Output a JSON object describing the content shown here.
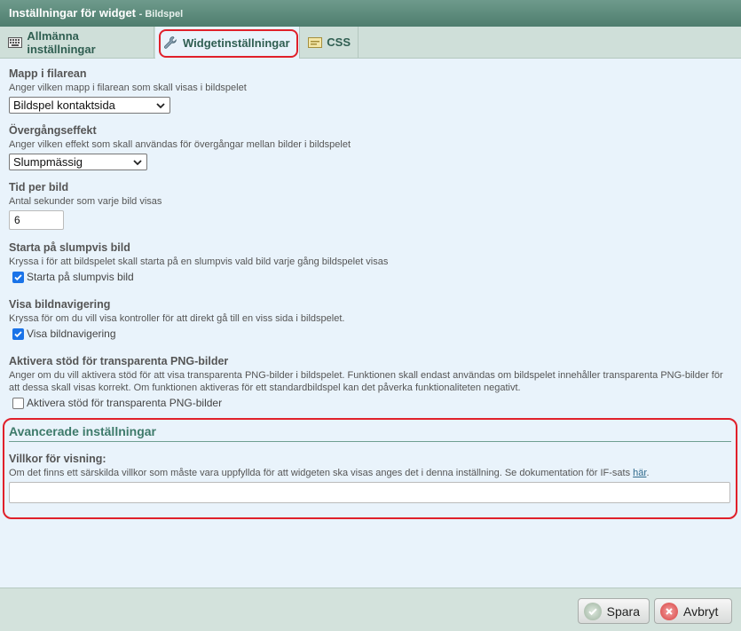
{
  "window": {
    "title": "Inställningar för widget",
    "subtitle": "- Bildspel"
  },
  "tabs": [
    {
      "label": "Allmänna inställningar",
      "icon": "keyboard-icon",
      "active": false
    },
    {
      "label": "Widgetinställningar",
      "icon": "wrench-icon",
      "active": true
    },
    {
      "label": "CSS",
      "icon": "css-icon",
      "active": false
    }
  ],
  "fields": {
    "folder": {
      "title": "Mapp i filarean",
      "desc": "Anger vilken mapp i filarean som skall visas i bildspelet",
      "value": "Bildspel kontaktsida"
    },
    "transition": {
      "title": "Övergångseffekt",
      "desc": "Anger vilken effekt som skall användas för övergångar mellan bilder i bildspelet",
      "value": "Slumpmässig"
    },
    "duration": {
      "title": "Tid per bild",
      "desc": "Antal sekunder som varje bild visas",
      "value": "6"
    },
    "random_start": {
      "title": "Starta på slumpvis bild",
      "desc": "Kryssa i för att bildspelet skall starta på en slumpvis vald bild varje gång bildspelet visas",
      "checkbox_label": "Starta på slumpvis bild",
      "checked": true
    },
    "navigation": {
      "title": "Visa bildnavigering",
      "desc": "Kryssa för om du vill visa kontroller för att direkt gå till en viss sida i bildspelet.",
      "checkbox_label": "Visa bildnavigering",
      "checked": true
    },
    "png": {
      "title": "Aktivera stöd för transparenta PNG-bilder",
      "desc": "Anger om du vill aktivera stöd för att visa transparenta PNG-bilder i bildspelet. Funktionen skall endast användas om bildspelet innehåller transparenta PNG-bilder för att dessa skall visas korrekt. Om funktionen aktiveras för ett standardbildspel kan det påverka funktionaliteten negativt.",
      "checkbox_label": "Aktivera stöd för transparenta PNG-bilder",
      "checked": false
    }
  },
  "advanced": {
    "heading": "Avancerade inställningar",
    "condition_title": "Villkor för visning:",
    "condition_desc": "Om det finns ett särskilda villkor som måste vara uppfyllda för att widgeten ska visas anges det i denna inställning. Se dokumentation för IF-sats",
    "condition_link": "här",
    "condition_suffix": ".",
    "condition_value": ""
  },
  "footer": {
    "save_label": "Spara",
    "cancel_label": "Avbryt"
  },
  "colors": {
    "accent_highlight": "#e0202a",
    "checkbox_blue": "#1a73e8",
    "title_green": "#4e7d6e"
  }
}
